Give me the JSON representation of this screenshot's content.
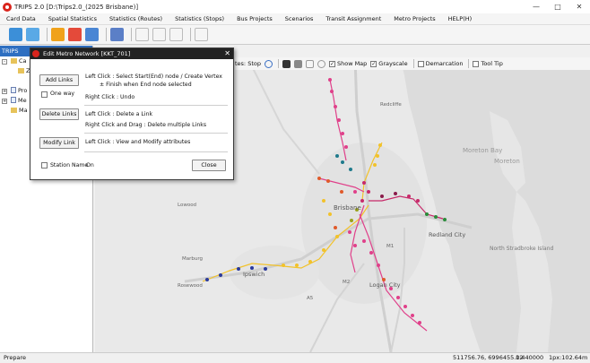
{
  "window": {
    "title": "TRIPS 2.0 [D:\\Trips2.0_(2025 Brisbane)]"
  },
  "menu": [
    "Card Data",
    "Spatial Statistics",
    "Statistics (Routes)",
    "Statistics (Stops)",
    "Bus Projects",
    "Scenarios",
    "Transit Assignment",
    "Metro Projects",
    "HELP(H)"
  ],
  "left_panel": {
    "header": "TRIPS",
    "items": [
      "Ca",
      "Z",
      "Pro",
      "Me",
      "Ma"
    ]
  },
  "map_toolbar": {
    "stops_label": "tes: Stop",
    "show_map": "Show Map",
    "grayscale": "Grayscale",
    "demarcation": "Demarcation",
    "tool_tip": "Tool Tip"
  },
  "map_labels": {
    "brisbane": "Brisbane",
    "redcliffe": "Redcliffe",
    "moreton_bay": "Moreton Bay",
    "moreton": "Moreton",
    "redland_city": "Redland City",
    "north_stradbroke": "North Stradbroke Island",
    "logan_city": "Logan City",
    "ipswich": "Ipswich",
    "marburg": "Marburg",
    "lowood": "Lowood",
    "rosewood": "Rosewood",
    "m1": "M1",
    "m2": "M2",
    "a5": "A5"
  },
  "dialog": {
    "title": "Edit Metro Network [KKT_701]",
    "add_links": "Add Links",
    "add_info_1": "Left Click : Select Start(End) node / Create Vertex",
    "add_info_2": "± Finish when End node selected",
    "right_click_undo": "Right Click : Undo",
    "one_way": "One way",
    "delete_links": "Delete Links",
    "delete_info_1": "Left Click : Delete a Link",
    "delete_info_2": "Right Click and Drag : Delete multiple Links",
    "modify_link": "Modify Link",
    "modify_info": "Left Click : View and Modify attributes",
    "station_name": "Station Name",
    "station_value": "On",
    "close": "Close"
  },
  "status": {
    "left": "Prepare",
    "coords": "511756.76, 6996455.02",
    "scale": "1:440000",
    "pixel": "1px:102.64m"
  },
  "colors": {
    "brand": "#d9241c",
    "dialog_title": "#222222",
    "panel_header": "#2e6fc1"
  }
}
